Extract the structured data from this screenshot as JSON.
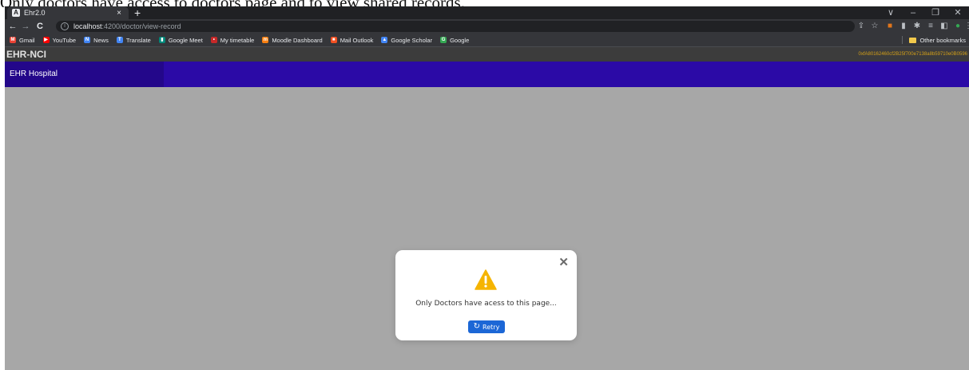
{
  "caption": "Only doctors have access to doctors page and to view shared records.",
  "browser": {
    "tab_favicon": "A",
    "tab_title": "Ehr2.0",
    "tab_close": "×",
    "new_tab": "+",
    "window_controls": [
      "∨",
      "–",
      "❐",
      "✕"
    ],
    "nav": {
      "back": "←",
      "forward": "→",
      "reload": "C"
    },
    "url_host": "localhost",
    "url_path": ":4200/doctor/view-record",
    "bookmarks": [
      {
        "label": "Gmail",
        "icon": "gmail-icon",
        "glyph": "M",
        "color": "#ea4335"
      },
      {
        "label": "YouTube",
        "icon": "youtube-icon",
        "glyph": "▶",
        "color": "#ff0000"
      },
      {
        "label": "News",
        "icon": "news-icon",
        "glyph": "N",
        "color": "#4285f4"
      },
      {
        "label": "Translate",
        "icon": "translate-icon",
        "glyph": "T",
        "color": "#4285f4"
      },
      {
        "label": "Google Meet",
        "icon": "meet-icon",
        "glyph": "▮",
        "color": "#00897b"
      },
      {
        "label": "My timetable",
        "icon": "timetable-icon",
        "glyph": "•",
        "color": "#c62828"
      },
      {
        "label": "Moodle Dashboard",
        "icon": "moodle-icon",
        "glyph": "m",
        "color": "#f98012"
      },
      {
        "label": "Mail Outlook",
        "icon": "microsoft-icon",
        "glyph": "■",
        "color": "#f25022"
      },
      {
        "label": "Google Scholar",
        "icon": "scholar-icon",
        "glyph": "▲",
        "color": "#4285f4"
      },
      {
        "label": "Google",
        "icon": "google-icon",
        "glyph": "G",
        "color": "#34a853"
      }
    ],
    "other_bookmarks": "Other bookmarks"
  },
  "app": {
    "brand": "EHR-NCI",
    "account": "0xfA80162460cf2B25f700e7138a8b59710e0B0596"
  },
  "page": {
    "nav_brand": "EHR Hospital"
  },
  "modal": {
    "close": "✕",
    "icon": "warning-icon",
    "message": "Only Doctors have acess to this page...",
    "retry_icon": "↻",
    "retry_label": "Retry"
  },
  "colors": {
    "nav_header": "#2b0aa6",
    "nav_brand_bg": "#23078a",
    "overlay": "#a7a7a7",
    "warning": "#f5b400",
    "retry_button": "#1c67d6"
  }
}
